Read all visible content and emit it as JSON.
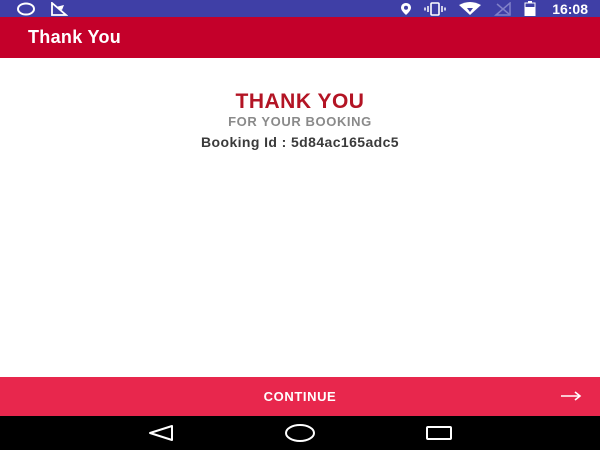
{
  "status_bar": {
    "time": "16:08",
    "icons": [
      "sync-circle-icon",
      "notification-icon",
      "location-icon",
      "vibrate-icon",
      "wifi-icon",
      "no-signal-icon",
      "battery-icon"
    ]
  },
  "app_bar": {
    "title": "Thank You",
    "color": "#c4002a"
  },
  "main": {
    "headline": "THANK YOU",
    "subheadline": "FOR YOUR BOOKING",
    "booking_id_text": "Booking Id : 5d84ac165adc5",
    "headline_color": "#b31424"
  },
  "continue_bar": {
    "label": "CONTINUE",
    "icon": "arrow-right-icon",
    "color": "#e8274d"
  },
  "nav_bar": {
    "icons": [
      "back-icon",
      "home-icon",
      "recents-icon"
    ]
  }
}
